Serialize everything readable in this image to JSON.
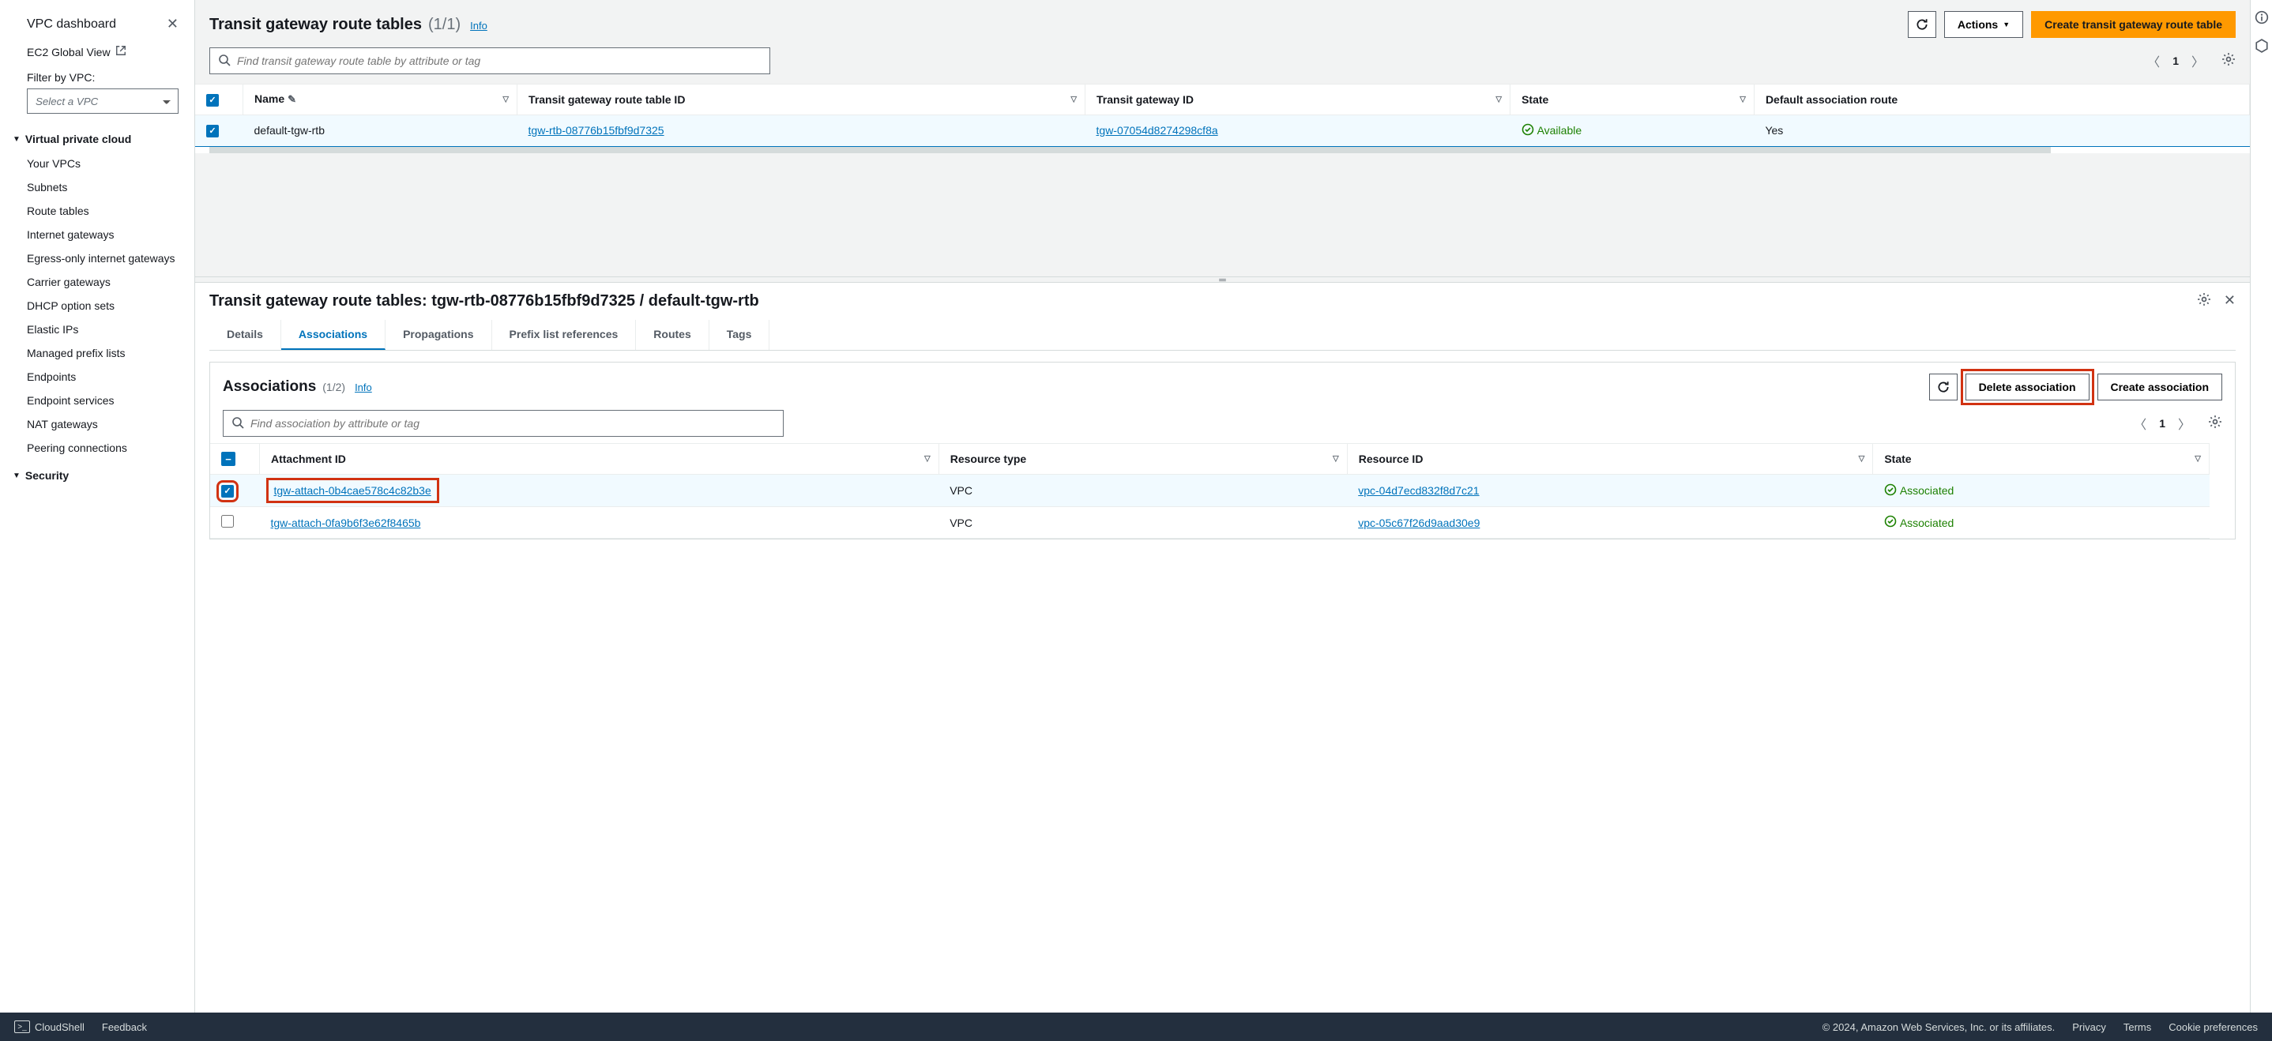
{
  "sidebar": {
    "dashboard": "VPC dashboard",
    "ec2_global": "EC2 Global View",
    "filter_label": "Filter by VPC:",
    "filter_placeholder": "Select a VPC",
    "groups": [
      {
        "title": "Virtual private cloud",
        "items": [
          "Your VPCs",
          "Subnets",
          "Route tables",
          "Internet gateways",
          "Egress-only internet gateways",
          "Carrier gateways",
          "DHCP option sets",
          "Elastic IPs",
          "Managed prefix lists",
          "Endpoints",
          "Endpoint services",
          "NAT gateways",
          "Peering connections"
        ]
      },
      {
        "title": "Security",
        "items": []
      }
    ]
  },
  "top": {
    "title": "Transit gateway route tables",
    "count": "(1/1)",
    "info": "Info",
    "actions_label": "Actions",
    "create_label": "Create transit gateway route table",
    "search_placeholder": "Find transit gateway route table by attribute or tag",
    "page": "1",
    "columns": {
      "name": "Name",
      "rtb_id": "Transit gateway route table ID",
      "tgw_id": "Transit gateway ID",
      "state": "State",
      "default_assoc": "Default association route"
    },
    "rows": [
      {
        "name": "default-tgw-rtb",
        "rtb_id": "tgw-rtb-08776b15fbf9d7325",
        "tgw_id": "tgw-07054d8274298cf8a",
        "state": "Available",
        "default_assoc": "Yes"
      }
    ]
  },
  "bottom": {
    "title": "Transit gateway route tables: tgw-rtb-08776b15fbf9d7325 / default-tgw-rtb",
    "tabs": [
      "Details",
      "Associations",
      "Propagations",
      "Prefix list references",
      "Routes",
      "Tags"
    ],
    "active_tab": "Associations",
    "assoc": {
      "title": "Associations",
      "count": "(1/2)",
      "info": "Info",
      "delete_label": "Delete association",
      "create_label": "Create association",
      "search_placeholder": "Find association by attribute or tag",
      "page": "1",
      "columns": {
        "attach_id": "Attachment ID",
        "res_type": "Resource type",
        "res_id": "Resource ID",
        "state": "State"
      },
      "rows": [
        {
          "attach_id": "tgw-attach-0b4cae578c4c82b3e",
          "res_type": "VPC",
          "res_id": "vpc-04d7ecd832f8d7c21",
          "state": "Associated",
          "checked": true
        },
        {
          "attach_id": "tgw-attach-0fa9b6f3e62f8465b",
          "res_type": "VPC",
          "res_id": "vpc-05c67f26d9aad30e9",
          "state": "Associated",
          "checked": false
        }
      ]
    }
  },
  "footer": {
    "cloudshell": "CloudShell",
    "feedback": "Feedback",
    "copyright": "© 2024, Amazon Web Services, Inc. or its affiliates.",
    "privacy": "Privacy",
    "terms": "Terms",
    "cookie": "Cookie preferences"
  }
}
